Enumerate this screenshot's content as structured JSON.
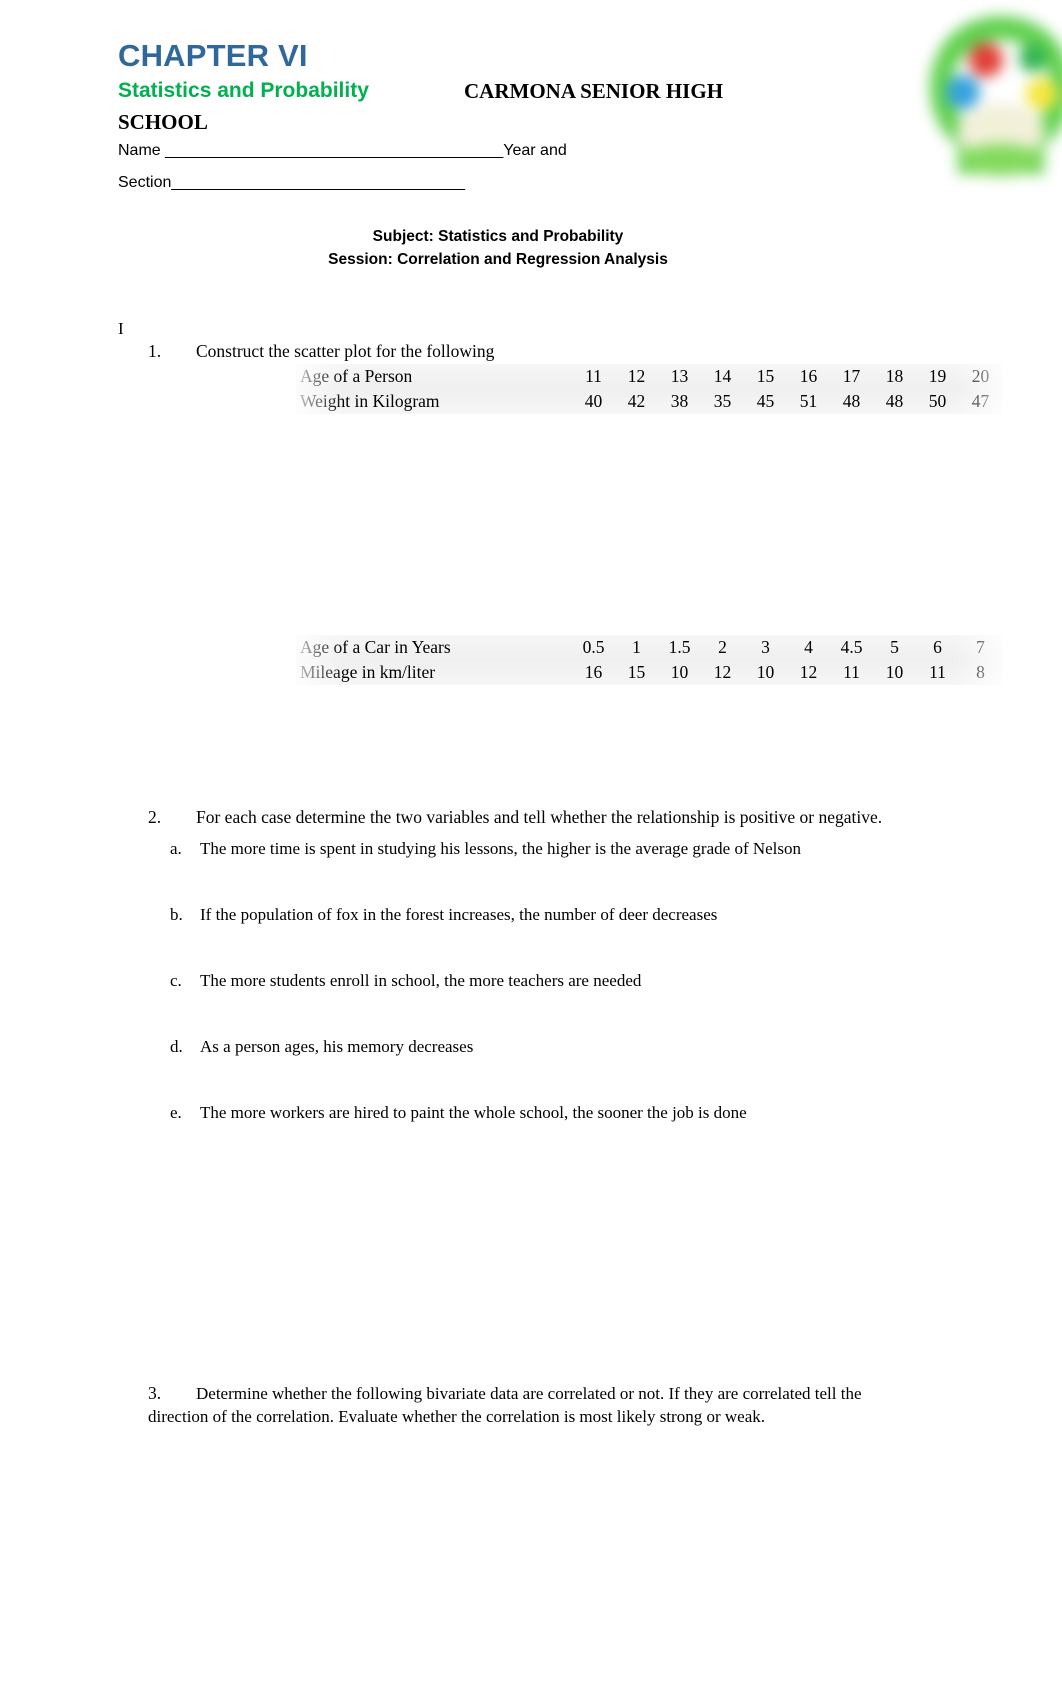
{
  "header": {
    "chapter_title": "CHAPTER VI",
    "doc_subtitle": "Statistics and Probability",
    "school_name_line1": "CARMONA SENIOR HIGH",
    "school_name_line2": "SCHOOL",
    "name_field": "Name ______________________________________Year and",
    "section_field": "Section_________________________________",
    "logo_name": "school-logo"
  },
  "subject": {
    "line1": "Subject: Statistics and Probability",
    "line2": "Session: Correlation and Regression Analysis"
  },
  "body": {
    "roman_numeral": "I",
    "q1": {
      "number": "1.",
      "text": "Construct the scatter plot for the following"
    },
    "q2": {
      "number": "2.",
      "text": "For each case determine the two variables and tell whether the relationship is positive or negative.",
      "items": [
        {
          "marker": "a.",
          "text": "The more time is spent in studying his lessons, the higher is the average grade of Nelson"
        },
        {
          "marker": "b.",
          "text": "If the population of fox in the forest increases, the number of deer decreases"
        },
        {
          "marker": "c.",
          "text": "The more students enroll in school, the more teachers are needed"
        },
        {
          "marker": "d.",
          "text": "As a person ages, his memory decreases"
        },
        {
          "marker": "e.",
          "text": "The more workers are hired to paint the whole school, the sooner the job is done"
        }
      ]
    },
    "q3": {
      "number": "3.",
      "text": "Determine whether the following bivariate data are correlated or not. If they are correlated tell the direction of the correlation. Evaluate whether the correlation is most likely strong or weak."
    }
  },
  "chart_data": [
    {
      "type": "table",
      "title": "Age of a Person vs Weight in Kilogram",
      "rows": [
        {
          "label": "Age of a Person",
          "values": [
            "11",
            "12",
            "13",
            "14",
            "15",
            "16",
            "17",
            "18",
            "19",
            "20"
          ]
        },
        {
          "label": "Weight in Kilogram",
          "values": [
            "40",
            "42",
            "38",
            "35",
            "45",
            "51",
            "48",
            "48",
            "50",
            "47"
          ]
        }
      ]
    },
    {
      "type": "table",
      "title": "Age of a Car in Years vs Mileage in km/liter",
      "rows": [
        {
          "label": "Age of a Car in Years",
          "values": [
            "0.5",
            "1",
            "1.5",
            "2",
            "3",
            "4",
            "4.5",
            "5",
            "6",
            "7"
          ]
        },
        {
          "label": "Mileage in km/liter",
          "values": [
            "16",
            "15",
            "10",
            "12",
            "10",
            "12",
            "11",
            "10",
            "11",
            "8"
          ]
        }
      ]
    }
  ],
  "colors": {
    "chapter_blue": "#31689b",
    "subtitle_green": "#00b14f",
    "table_bg": "#f2f2f2"
  }
}
